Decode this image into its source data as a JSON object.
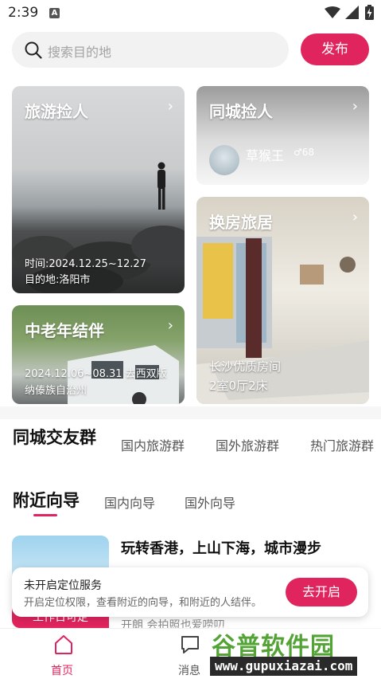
{
  "status_bar": {
    "time": "2:39",
    "notification_letter": "A"
  },
  "search": {
    "placeholder": "搜索目的地"
  },
  "publish_button": "发布",
  "cards": {
    "travel": {
      "title": "旅游捡人",
      "time_line": "时间:2024.12.25~12.27",
      "dest_line": "目的地:洛阳市"
    },
    "city": {
      "title": "同城捡人",
      "user_name": "草猴王",
      "user_meta": "♂68"
    },
    "house": {
      "title": "换房旅居",
      "desc_line1": "长沙优质房间",
      "desc_line2": "2室0厅2床"
    },
    "elder": {
      "title": "中老年结伴",
      "desc_line1": "2024.12.06~08.31 去西双版",
      "desc_line2": "纳傣族自治州"
    }
  },
  "group_tabs": [
    "同城交友群",
    "国内旅游群",
    "国外旅游群",
    "热门旅游群"
  ],
  "guide_tabs": [
    "附近向导",
    "国内向导",
    "国外向导"
  ],
  "guide_item": {
    "title": "玩转香港，上山下海，城市漫步",
    "badge": "工作日可定",
    "subtitle": "开朗 会拍照也爱唠叨"
  },
  "location_toast": {
    "title": "未开启定位服务",
    "message": "开启定位权限，查看附近的向导，和附近的人结伴。",
    "button": "去开启"
  },
  "bottom_nav": {
    "home": "首页",
    "messages": "消息"
  },
  "watermark": {
    "brand": "谷普软件园",
    "url": "www.gupuxiazai.com"
  },
  "colors": {
    "accent": "#e0245e",
    "watermark_green": "#53a336"
  }
}
